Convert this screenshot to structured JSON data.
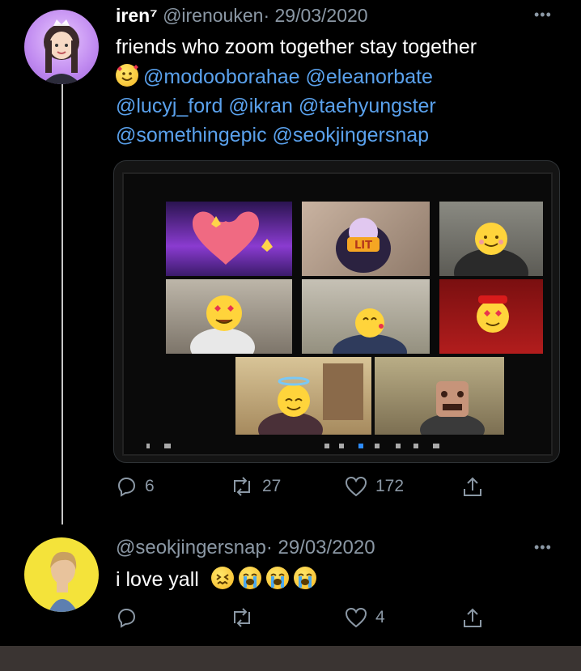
{
  "tweet": {
    "author_name": "iren⁷",
    "handle": "@irenouken",
    "date": "· 29/03/2020",
    "text": "friends who zoom together stay together",
    "mentions_line1": "@modooborahae @eleanorbate",
    "mentions_line2": "@lucyj_ford @ikran @taehyungster",
    "mentions_line3": "@somethingepic @seokjingersnap",
    "replies_count": "6",
    "retweets_count": "27",
    "likes_count": "172",
    "media_tile_label": "LIT"
  },
  "reply": {
    "handle": "@seokjingersnap",
    "date": "· 29/03/2020",
    "text": "i love yall",
    "replies_count": "",
    "retweets_count": "",
    "likes_count": "4"
  },
  "more_icon_text": "•••",
  "colors": {
    "background": "#000000",
    "mention": "#5aa1ec",
    "secondary_text": "#8b98a5",
    "thread_line": "#c8c8c8"
  }
}
